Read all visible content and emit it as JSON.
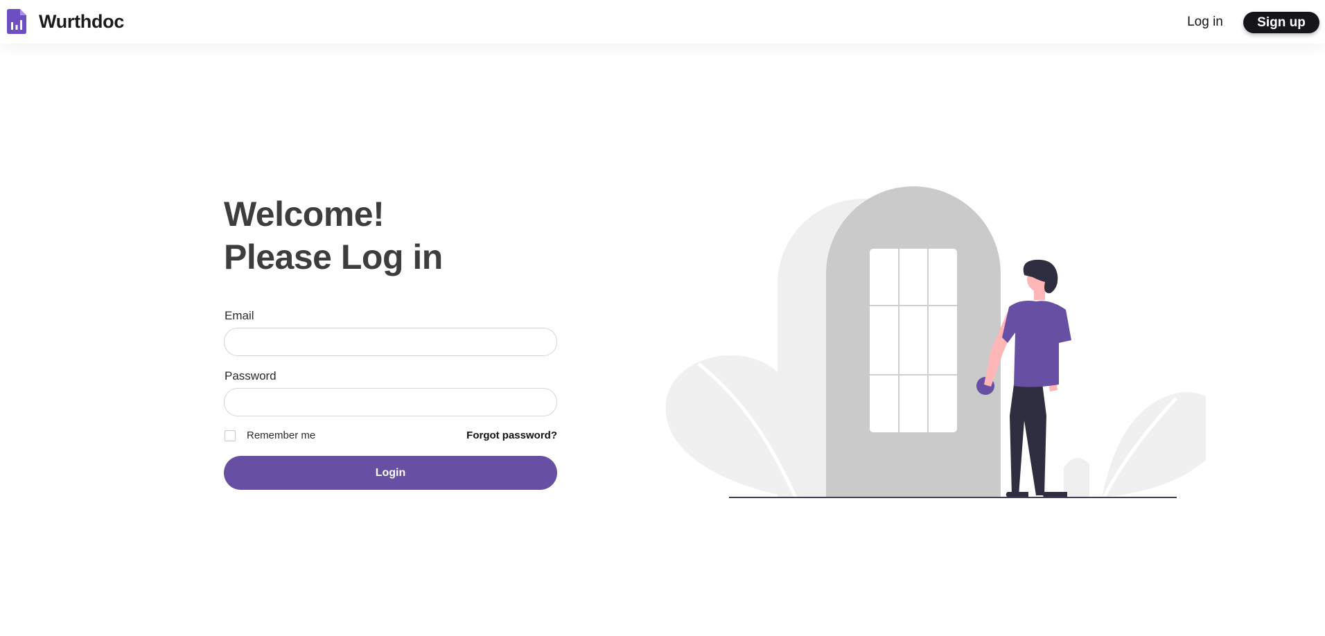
{
  "brand": {
    "name": "Wurthdoc",
    "logo_icon": "document-chart-icon",
    "accent_color": "#6750a4"
  },
  "nav": {
    "login_label": "Log in",
    "signup_label": "Sign up"
  },
  "form": {
    "heading_line1": "Welcome!",
    "heading_line2": "Please Log in",
    "email_label": "Email",
    "email_value": "",
    "email_placeholder": "",
    "password_label": "Password",
    "password_value": "",
    "password_placeholder": "",
    "remember_label": "Remember me",
    "remember_checked": false,
    "forgot_label": "Forgot password?",
    "submit_label": "Login",
    "button_color": "#6750a4"
  },
  "illustration": {
    "icon": "person-at-door-illustration"
  }
}
